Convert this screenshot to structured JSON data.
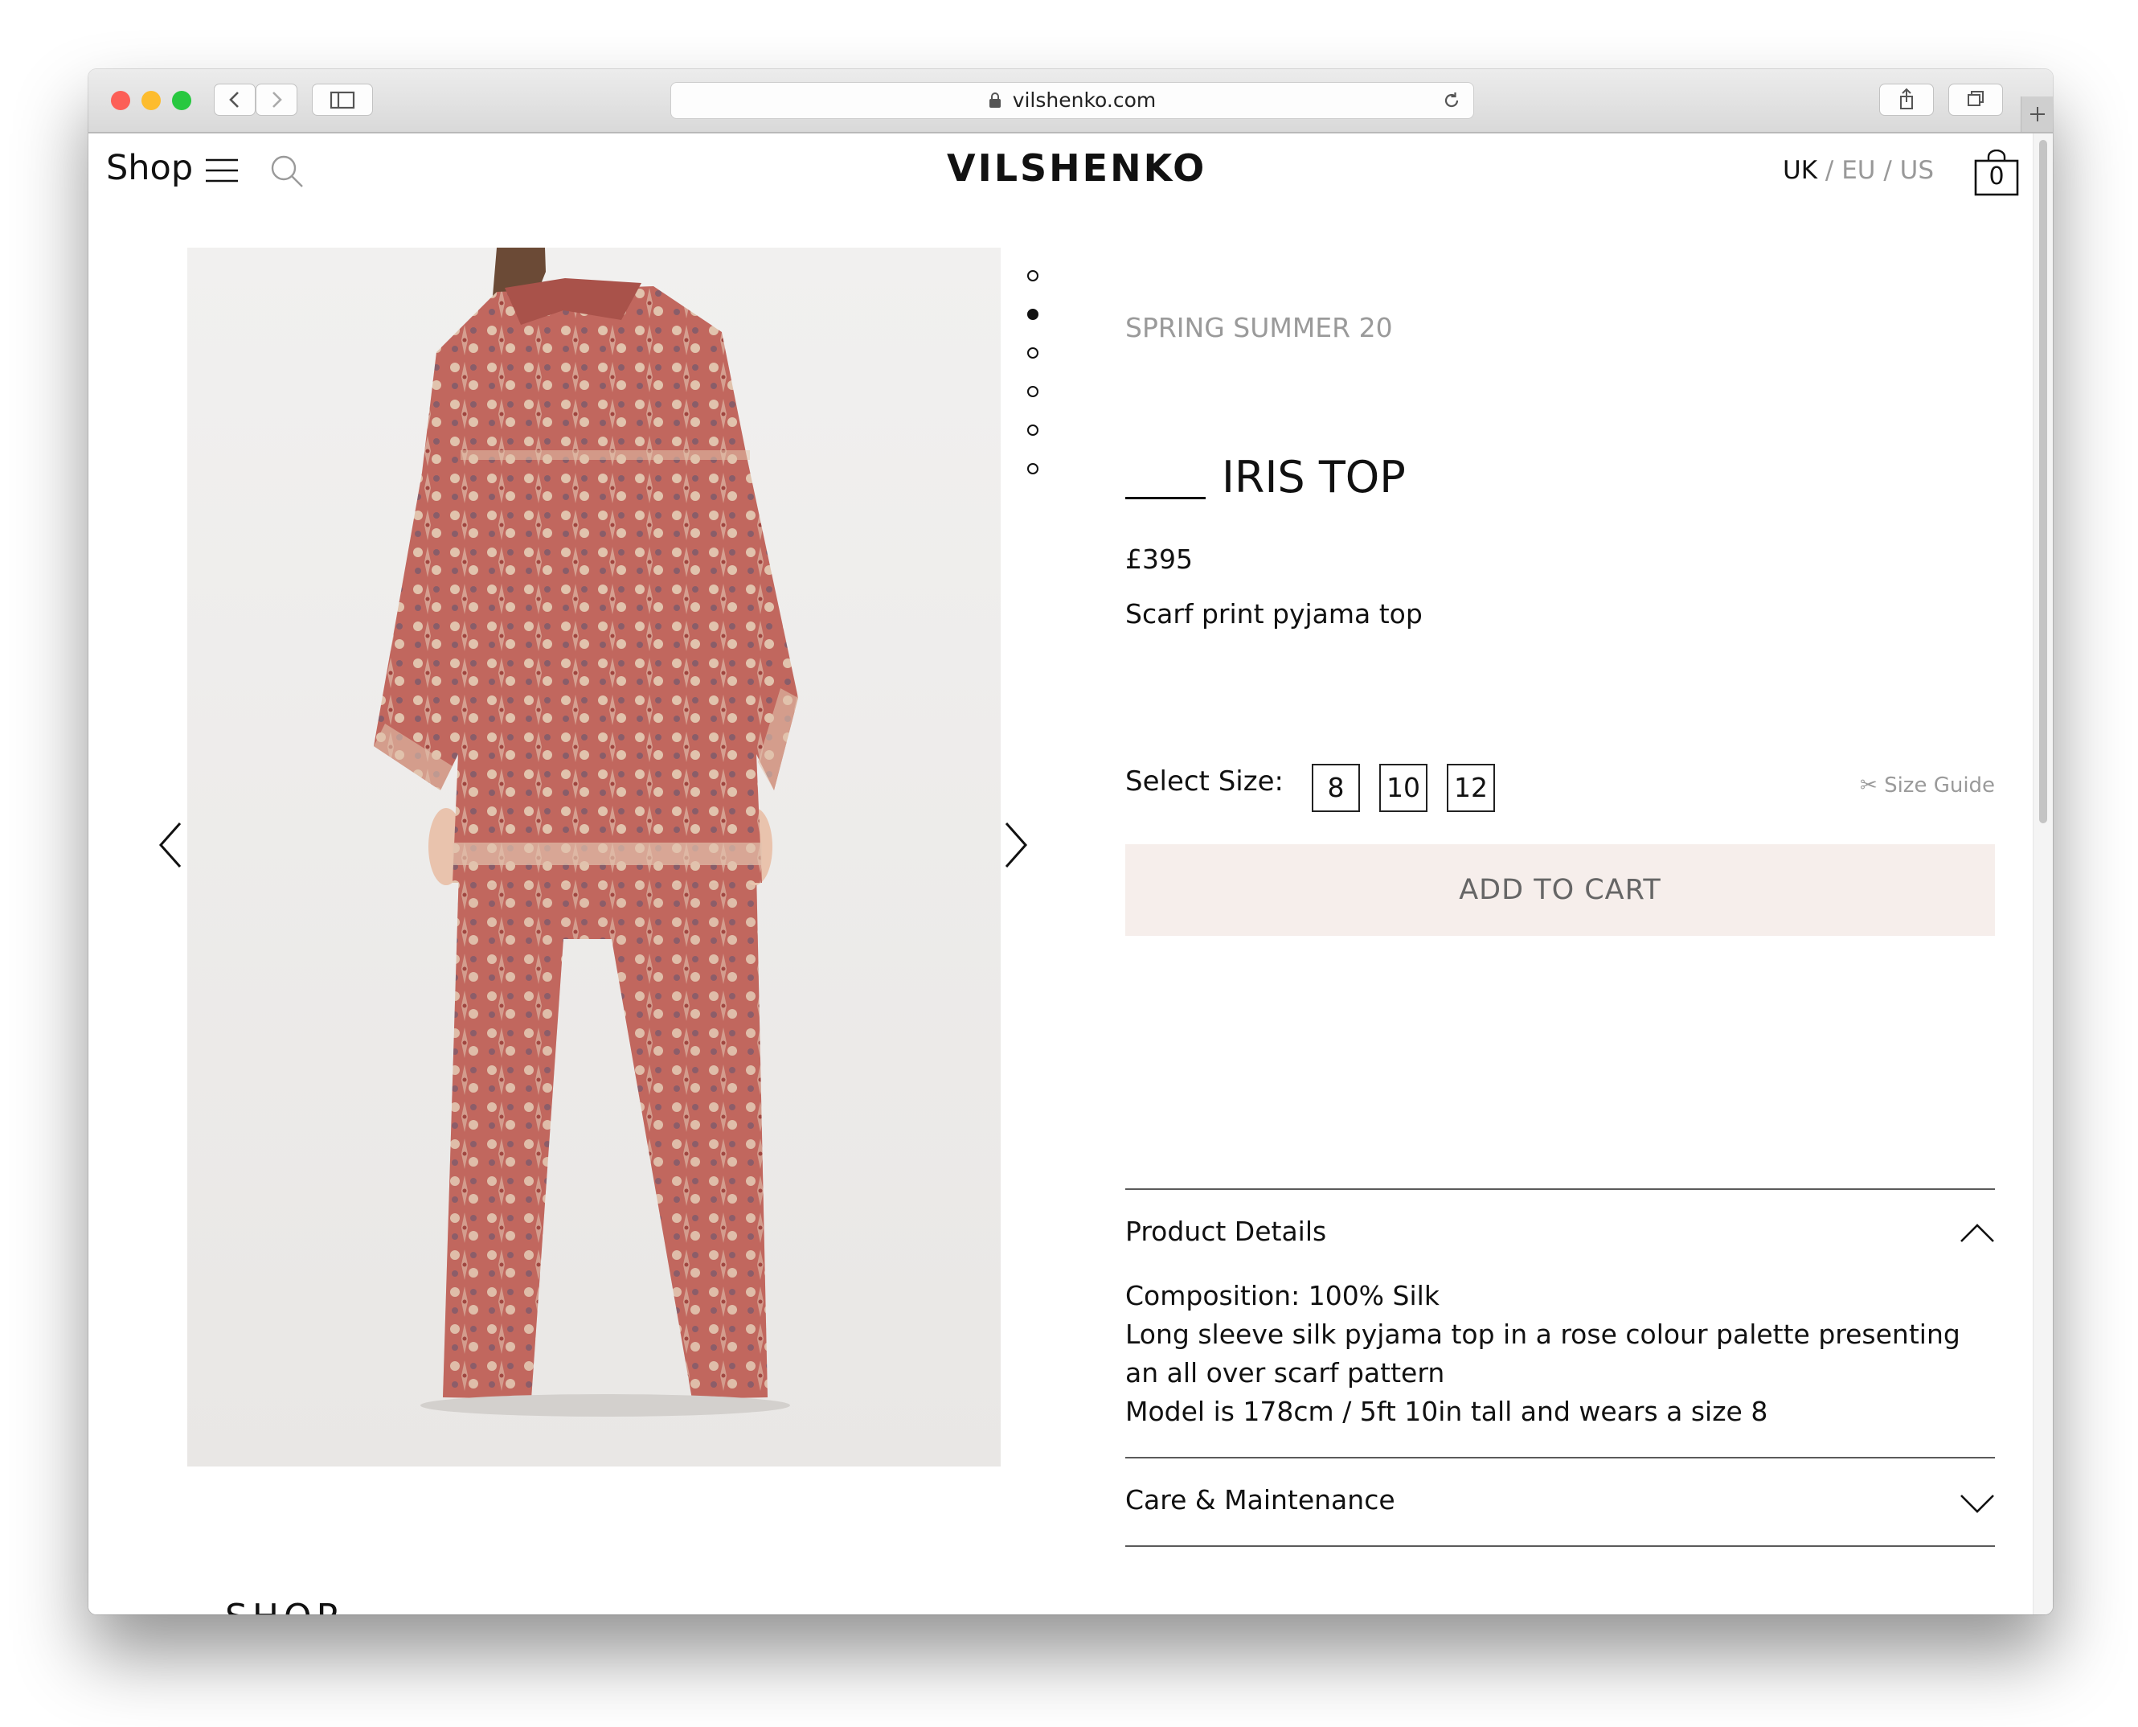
{
  "browser": {
    "url": "vilshenko.com",
    "traffic_lights": [
      "#fc5f57",
      "#fdbc2e",
      "#28c840"
    ]
  },
  "header": {
    "shop_label": "Shop",
    "brand": "VILSHENKO",
    "region_uk": "UK",
    "region_eu": "EU",
    "region_us": "US",
    "region_sep": " / ",
    "cart_count": "0"
  },
  "gallery": {
    "image_count": 6,
    "active_index": 1
  },
  "product": {
    "collection": "SPRING SUMMER 20",
    "title": "IRIS TOP",
    "price": "£395",
    "short_description": "Scarf print pyjama top",
    "select_size_label": "Select Size:",
    "sizes": [
      "8",
      "10",
      "12"
    ],
    "size_guide_label": "Size Guide",
    "add_to_cart_label": "ADD TO CART"
  },
  "accordion": {
    "details_title": "Product Details",
    "details_lines": [
      "Composition: 100% Silk",
      "Long sleeve silk pyjama top in a rose colour palette presenting an all over scarf pattern",
      "Model is 178cm / 5ft 10in tall and wears a size 8"
    ],
    "care_title": "Care & Maintenance"
  },
  "footer_peek": {
    "text": "SHOP"
  },
  "colors": {
    "add_to_cart_bg": "#f6eeeb",
    "muted_text": "#9a9a9a",
    "fabric_base": "#c46a61"
  }
}
